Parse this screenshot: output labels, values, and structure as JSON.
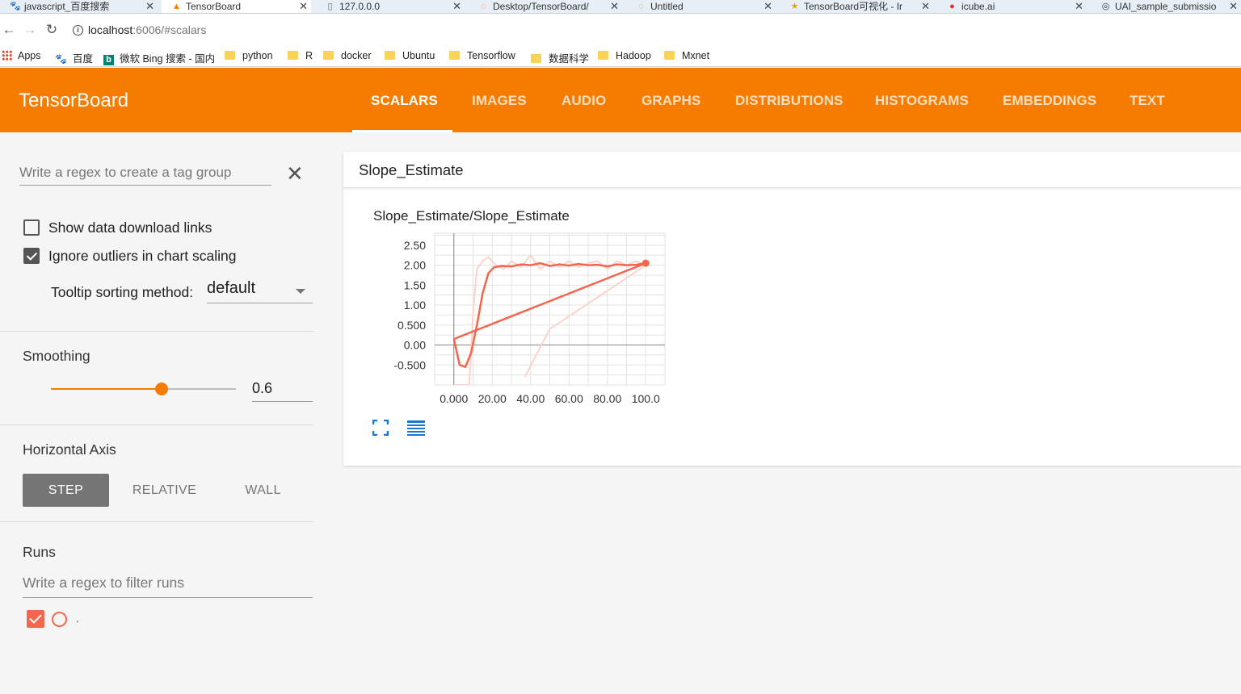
{
  "browser": {
    "tabs": [
      {
        "title": "javascript_百度搜索",
        "favicon": "paw-icon"
      },
      {
        "title": "TensorBoard",
        "favicon": "tensorboard-icon",
        "active": true
      },
      {
        "title": "127.0.0.0",
        "favicon": "page-icon"
      },
      {
        "title": "Desktop/TensorBoard/",
        "favicon": "jupyter-icon"
      },
      {
        "title": "Untitled",
        "favicon": "jupyter-icon"
      },
      {
        "title": "TensorBoard可视化 - Ir",
        "favicon": "star-icon"
      },
      {
        "title": "icube.ai",
        "favicon": "icube-icon"
      },
      {
        "title": "UAI_sample_submissio",
        "favicon": "github-icon"
      }
    ],
    "url_host": "localhost",
    "url_rest": ":6006/#scalars",
    "bookmarks": [
      "Apps",
      "百度",
      "微软 Bing 搜索 - 国内",
      "python",
      "R",
      "docker",
      "Ubuntu",
      "Tensorflow",
      "数据科学",
      "Hadoop",
      "Mxnet"
    ]
  },
  "header": {
    "title": "TensorBoard",
    "tabs": [
      "SCALARS",
      "IMAGES",
      "AUDIO",
      "GRAPHS",
      "DISTRIBUTIONS",
      "HISTOGRAMS",
      "EMBEDDINGS",
      "TEXT"
    ],
    "active_tab": "SCALARS",
    "color": "#f57c00"
  },
  "sidebar": {
    "regex_placeholder": "Write a regex to create a tag group",
    "show_download_label": "Show data download links",
    "show_download_checked": false,
    "ignore_outliers_label": "Ignore outliers in chart scaling",
    "ignore_outliers_checked": true,
    "tooltip_label": "Tooltip sorting method:",
    "tooltip_value": "default",
    "smoothing_title": "Smoothing",
    "smoothing_value": "0.6",
    "smoothing_fraction": 0.6,
    "horizontal_axis_title": "Horizontal Axis",
    "axis_options": [
      "STEP",
      "RELATIVE",
      "WALL"
    ],
    "axis_selected": "STEP",
    "runs_title": "Runs",
    "runs_filter_placeholder": "Write a regex to filter runs",
    "runs": [
      {
        "name": ".",
        "checked": true,
        "color": "#f4664d"
      }
    ]
  },
  "card": {
    "title": "Slope_Estimate",
    "chart_title": "Slope_Estimate/Slope_Estimate"
  },
  "chart_data": {
    "type": "line",
    "title": "Slope_Estimate/Slope_Estimate",
    "xlabel": "",
    "ylabel": "",
    "xlim": [
      -10,
      110
    ],
    "ylim": [
      -1.0,
      2.8
    ],
    "x_ticks": [
      "0.000",
      "20.00",
      "40.00",
      "60.00",
      "80.00",
      "100.0"
    ],
    "y_ticks": [
      "2.50",
      "2.00",
      "1.50",
      "1.00",
      "0.500",
      "0.00",
      "-0.500"
    ],
    "grid": true,
    "series": [
      {
        "role": "smoothed",
        "color": "#f4664d",
        "x": [
          0,
          3,
          6,
          9,
          12,
          15,
          18,
          21,
          25,
          30,
          35,
          40,
          45,
          50,
          55,
          60,
          65,
          70,
          75,
          80,
          85,
          90,
          95,
          100,
          0
        ],
        "y": [
          0.15,
          -0.5,
          -0.55,
          -0.2,
          0.5,
          1.3,
          1.8,
          1.95,
          1.98,
          1.97,
          2.02,
          2.0,
          2.05,
          1.98,
          2.02,
          1.99,
          2.03,
          2.0,
          2.01,
          1.97,
          2.02,
          2.0,
          2.01,
          2.05,
          0.15
        ]
      },
      {
        "role": "raw",
        "color": "#fbd3c9",
        "x": [
          0,
          8,
          10,
          12,
          15,
          18,
          22,
          26,
          30,
          35,
          40,
          45,
          50,
          55,
          60,
          65,
          70,
          75,
          80,
          85,
          90,
          95,
          100,
          50,
          37
        ],
        "y": [
          -1.0,
          -1.0,
          0.8,
          1.9,
          2.1,
          2.2,
          2.0,
          1.9,
          2.1,
          1.95,
          2.25,
          1.9,
          2.1,
          1.95,
          2.1,
          1.95,
          2.05,
          2.1,
          1.9,
          2.1,
          2.0,
          2.1,
          2.0,
          0.4,
          -0.8
        ]
      }
    ]
  }
}
